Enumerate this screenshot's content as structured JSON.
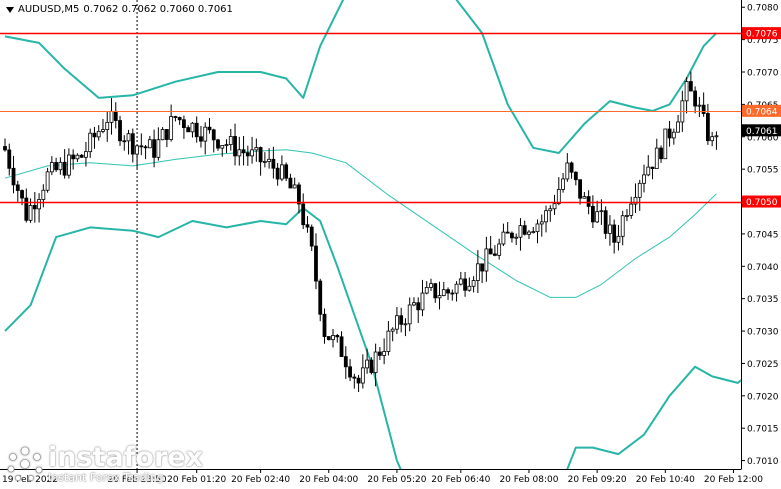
{
  "header": {
    "symbol": "AUDUSD,M5",
    "ohlc": "0.7062 0.7062 0.7060 0.7061"
  },
  "watermark": {
    "brand": "instaforex",
    "tagline": "Instant Forex Trading",
    "logo_icon": "instaforex-logo-icon"
  },
  "colors": {
    "band": "#26b5a6",
    "middle_band": "#2fc4b2",
    "level_line": "#ff0000",
    "level_label_bg": "#ff0000",
    "current_line": "#ff6a2a",
    "price_tag_bg": "#000000",
    "candle": "#000000",
    "axis_text": "#000000"
  },
  "chart_data": {
    "type": "candlestick",
    "y_ticks": [
      "0.7080",
      "0.7075",
      "0.7070",
      "0.7065",
      "0.7060",
      "0.7055",
      "0.7050",
      "0.7045",
      "0.7040",
      "0.7035",
      "0.7030",
      "0.7025",
      "0.7020",
      "0.7015",
      "0.7010"
    ],
    "y_tick_values": [
      0.708,
      0.7075,
      0.707,
      0.7065,
      0.706,
      0.7055,
      0.705,
      0.7045,
      0.704,
      0.7035,
      0.703,
      0.7025,
      0.702,
      0.7015,
      0.701
    ],
    "ylim": [
      0.70087,
      0.70805
    ],
    "x_ticks": [
      "20 Feb 23:50",
      "20 Feb 01:20",
      "20 Feb 02:40",
      "20 Feb 04:00",
      "20 Feb 05:20",
      "20 Feb 06:40",
      "20 Feb 08:00",
      "20 Feb 09:20",
      "20 Feb 10:40",
      "20 Feb 12:00"
    ],
    "x_tick_bar_index": [
      31,
      45,
      60,
      76,
      92,
      107,
      123,
      139,
      155,
      171
    ],
    "x_first_label": "19 Feb 2022",
    "bar_count": 168,
    "levels": [
      {
        "value": 0.7076,
        "label": "0.7076",
        "type": "resistance"
      },
      {
        "value": 0.705,
        "label": "0.7050",
        "type": "support"
      }
    ],
    "current_line": {
      "value": 0.7064,
      "label": "0.7064"
    },
    "last_price": {
      "value": 0.7061,
      "label": "0.7061"
    },
    "session_separator_bar_index": 31,
    "close_anchors": [
      [
        0,
        0.7058
      ],
      [
        5,
        0.7048
      ],
      [
        10,
        0.7054
      ],
      [
        18,
        0.7057
      ],
      [
        24,
        0.7063
      ],
      [
        30,
        0.7059
      ],
      [
        35,
        0.7058
      ],
      [
        40,
        0.7063
      ],
      [
        46,
        0.7061
      ],
      [
        55,
        0.7058
      ],
      [
        64,
        0.7055
      ],
      [
        69,
        0.705
      ],
      [
        72,
        0.7042
      ],
      [
        75,
        0.703
      ],
      [
        79,
        0.7027
      ],
      [
        83,
        0.7022
      ],
      [
        86,
        0.7025
      ],
      [
        91,
        0.703
      ],
      [
        96,
        0.7034
      ],
      [
        100,
        0.7036
      ],
      [
        104,
        0.7036
      ],
      [
        108,
        0.7038
      ],
      [
        113,
        0.7041
      ],
      [
        116,
        0.7043
      ],
      [
        120,
        0.7046
      ],
      [
        126,
        0.7047
      ],
      [
        128,
        0.7049
      ],
      [
        132,
        0.7055
      ],
      [
        136,
        0.705
      ],
      [
        140,
        0.7047
      ],
      [
        143,
        0.7044
      ],
      [
        147,
        0.7051
      ],
      [
        150,
        0.7055
      ],
      [
        153,
        0.7057
      ],
      [
        157,
        0.7062
      ],
      [
        160,
        0.7067
      ],
      [
        162,
        0.7066
      ],
      [
        164,
        0.7062
      ],
      [
        166,
        0.7059
      ],
      [
        167,
        0.7061
      ]
    ],
    "bollinger": {
      "upper": [
        [
          0,
          0.70755
        ],
        [
          8,
          0.70745
        ],
        [
          14,
          0.70705
        ],
        [
          22,
          0.7066
        ],
        [
          30,
          0.70664
        ],
        [
          40,
          0.70685
        ],
        [
          50,
          0.707
        ],
        [
          60,
          0.707
        ],
        [
          66,
          0.7069
        ],
        [
          70,
          0.7066
        ],
        [
          74,
          0.7074
        ],
        [
          80,
          0.7082
        ],
        [
          105,
          0.7082
        ],
        [
          112,
          0.7076
        ],
        [
          118,
          0.7065
        ],
        [
          124,
          0.70583
        ],
        [
          130,
          0.70575
        ],
        [
          136,
          0.7062
        ],
        [
          142,
          0.70655
        ],
        [
          148,
          0.70645
        ],
        [
          152,
          0.7064
        ],
        [
          156,
          0.7065
        ],
        [
          160,
          0.7069
        ],
        [
          164,
          0.7074
        ],
        [
          167,
          0.7076
        ]
      ],
      "middle": [
        [
          0,
          0.70536
        ],
        [
          10,
          0.70555
        ],
        [
          20,
          0.7056
        ],
        [
          30,
          0.70555
        ],
        [
          40,
          0.70565
        ],
        [
          50,
          0.70573
        ],
        [
          60,
          0.70578
        ],
        [
          66,
          0.7058
        ],
        [
          72,
          0.70575
        ],
        [
          80,
          0.7056
        ],
        [
          90,
          0.7051
        ],
        [
          100,
          0.70465
        ],
        [
          110,
          0.7042
        ],
        [
          120,
          0.70378
        ],
        [
          128,
          0.70352
        ],
        [
          134,
          0.70352
        ],
        [
          140,
          0.70372
        ],
        [
          148,
          0.70412
        ],
        [
          156,
          0.70445
        ],
        [
          162,
          0.7048
        ],
        [
          167,
          0.70512
        ]
      ],
      "lower": [
        [
          0,
          0.703
        ],
        [
          6,
          0.7034
        ],
        [
          12,
          0.70445
        ],
        [
          20,
          0.7046
        ],
        [
          30,
          0.70455
        ],
        [
          36,
          0.70445
        ],
        [
          44,
          0.7047
        ],
        [
          52,
          0.7046
        ],
        [
          60,
          0.7047
        ],
        [
          66,
          0.70465
        ],
        [
          70,
          0.7049
        ],
        [
          74,
          0.7047
        ],
        [
          78,
          0.704
        ],
        [
          86,
          0.7025
        ],
        [
          92,
          0.701
        ],
        [
          96,
          0.7004
        ],
        [
          128,
          0.7002
        ],
        [
          134,
          0.7012
        ],
        [
          138,
          0.7012
        ],
        [
          144,
          0.7011
        ],
        [
          150,
          0.7014
        ],
        [
          156,
          0.702
        ],
        [
          162,
          0.70245
        ],
        [
          166,
          0.7023
        ],
        [
          172,
          0.7022
        ],
        [
          176,
          0.7024
        ],
        [
          182,
          0.7027
        ]
      ]
    }
  }
}
